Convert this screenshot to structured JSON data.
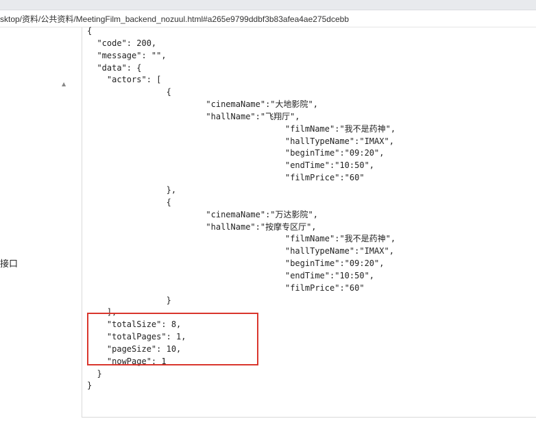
{
  "browser": {
    "url": "sktop/资料/公共资料/MeetingFilm_backend_nozuul.html#a265e9799ddbf3b83afea4ae275dcebb"
  },
  "sidebar": {
    "collapse_glyph": "▲",
    "item_label": "接口"
  },
  "code_block": {
    "lines": [
      "{",
      "  \"code\": 200,",
      "  \"message\": \"\",",
      "  \"data\": {",
      "    \"actors\": [",
      "                {",
      "                        \"cinemaName\":\"大地影院\",",
      "                        \"hallName\":\"飞翔厅\",",
      "                                        \"filmName\":\"我不是药神\",",
      "                                        \"hallTypeName\":\"IMAX\",",
      "                                        \"beginTime\":\"09:20\",",
      "                                        \"endTime\":\"10:50\",",
      "                                        \"filmPrice\":\"60\"",
      "                },",
      "                {",
      "                        \"cinemaName\":\"万达影院\",",
      "                        \"hallName\":\"按摩专区厅\",",
      "                                        \"filmName\":\"我不是药神\",",
      "                                        \"hallTypeName\":\"IMAX\",",
      "                                        \"beginTime\":\"09:20\",",
      "                                        \"endTime\":\"10:50\",",
      "                                        \"filmPrice\":\"60\"",
      "                }",
      "    ],",
      "    \"totalSize\": 8,",
      "    \"totalPages\": 1,",
      "    \"pageSize\": 10,",
      "    \"nowPage\": 1",
      "  }",
      "}"
    ]
  },
  "colors": {
    "highlight_border": "#d9352c"
  }
}
